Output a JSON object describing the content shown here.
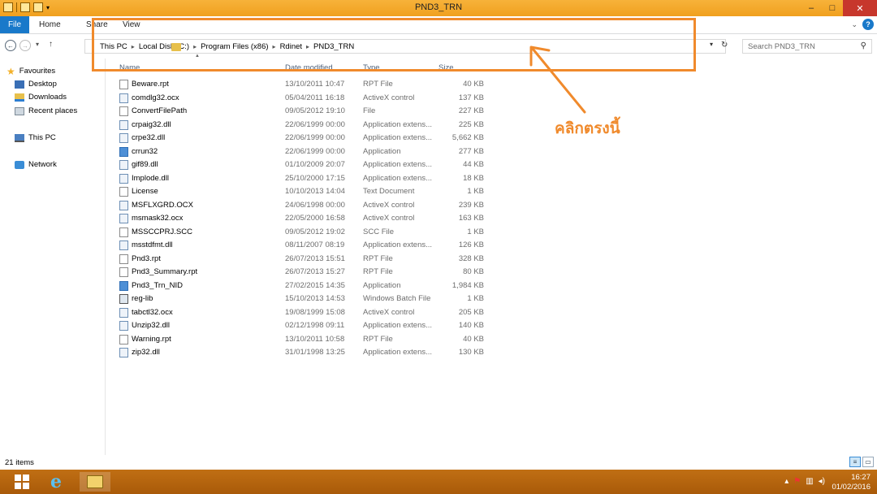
{
  "window": {
    "title": "PND3_TRN",
    "controls": [
      "–",
      "□",
      "✕"
    ]
  },
  "ribbon": {
    "tabs": [
      "File",
      "Home",
      "Share",
      "View"
    ]
  },
  "address": {
    "crumbs": [
      "This PC",
      "Local Disk (C:)",
      "Program Files (x86)",
      "Rdinet",
      "PND3_TRN"
    ],
    "search_placeholder": "Search PND3_TRN"
  },
  "annotation": {
    "text": "คลิกตรงนี้",
    "color": "#f08a2c"
  },
  "navpane": {
    "favourites": "Favourites",
    "items": [
      "Desktop",
      "Downloads",
      "Recent places"
    ],
    "this_pc": "This PC",
    "network": "Network"
  },
  "columns": {
    "name": "Name",
    "date": "Date modified",
    "type": "Type",
    "size": "Size"
  },
  "files": [
    {
      "name": "Beware.rpt",
      "date": "13/10/2011 10:47",
      "type": "RPT File",
      "size": "40 KB",
      "icon": "file-icon"
    },
    {
      "name": "comdlg32.ocx",
      "date": "05/04/2011 16:18",
      "type": "ActiveX control",
      "size": "137 KB",
      "icon": "dll-icon"
    },
    {
      "name": "ConvertFilePath",
      "date": "09/05/2012 19:10",
      "type": "File",
      "size": "227 KB",
      "icon": "file-icon"
    },
    {
      "name": "crpaig32.dll",
      "date": "22/06/1999 00:00",
      "type": "Application extens...",
      "size": "225 KB",
      "icon": "dll-icon"
    },
    {
      "name": "crpe32.dll",
      "date": "22/06/1999 00:00",
      "type": "Application extens...",
      "size": "5,662 KB",
      "icon": "dll-icon"
    },
    {
      "name": "crrun32",
      "date": "22/06/1999 00:00",
      "type": "Application",
      "size": "277 KB",
      "icon": "app-icon"
    },
    {
      "name": "gif89.dll",
      "date": "01/10/2009 20:07",
      "type": "Application extens...",
      "size": "44 KB",
      "icon": "dll-icon"
    },
    {
      "name": "Implode.dll",
      "date": "25/10/2000 17:15",
      "type": "Application extens...",
      "size": "18 KB",
      "icon": "dll-icon"
    },
    {
      "name": "License",
      "date": "10/10/2013 14:04",
      "type": "Text Document",
      "size": "1 KB",
      "icon": "file-icon"
    },
    {
      "name": "MSFLXGRD.OCX",
      "date": "24/06/1998 00:00",
      "type": "ActiveX control",
      "size": "239 KB",
      "icon": "dll-icon"
    },
    {
      "name": "msmask32.ocx",
      "date": "22/05/2000 16:58",
      "type": "ActiveX control",
      "size": "163 KB",
      "icon": "dll-icon"
    },
    {
      "name": "MSSCCPRJ.SCC",
      "date": "09/05/2012 19:02",
      "type": "SCC File",
      "size": "1 KB",
      "icon": "file-icon"
    },
    {
      "name": "msstdfmt.dll",
      "date": "08/11/2007 08:19",
      "type": "Application extens...",
      "size": "126 KB",
      "icon": "dll-icon"
    },
    {
      "name": "Pnd3.rpt",
      "date": "26/07/2013 15:51",
      "type": "RPT File",
      "size": "328 KB",
      "icon": "file-icon"
    },
    {
      "name": "Pnd3_Summary.rpt",
      "date": "26/07/2013 15:27",
      "type": "RPT File",
      "size": "80 KB",
      "icon": "file-icon"
    },
    {
      "name": "Pnd3_Trn_NID",
      "date": "27/02/2015 14:35",
      "type": "Application",
      "size": "1,984 KB",
      "icon": "app-icon"
    },
    {
      "name": "reg-lib",
      "date": "15/10/2013 14:53",
      "type": "Windows Batch File",
      "size": "1 KB",
      "icon": "bat-icon"
    },
    {
      "name": "tabctl32.ocx",
      "date": "19/08/1999 15:08",
      "type": "ActiveX control",
      "size": "205 KB",
      "icon": "dll-icon"
    },
    {
      "name": "Unzip32.dll",
      "date": "02/12/1998 09:11",
      "type": "Application extens...",
      "size": "140 KB",
      "icon": "dll-icon"
    },
    {
      "name": "Warning.rpt",
      "date": "13/10/2011 10:58",
      "type": "RPT File",
      "size": "40 KB",
      "icon": "file-icon"
    },
    {
      "name": "zip32.dll",
      "date": "31/01/1998 13:25",
      "type": "Application extens...",
      "size": "130 KB",
      "icon": "dll-icon"
    }
  ],
  "status": {
    "item_count": "21 items"
  },
  "taskbar": {
    "time": "16:27",
    "date": "01/02/2016"
  }
}
